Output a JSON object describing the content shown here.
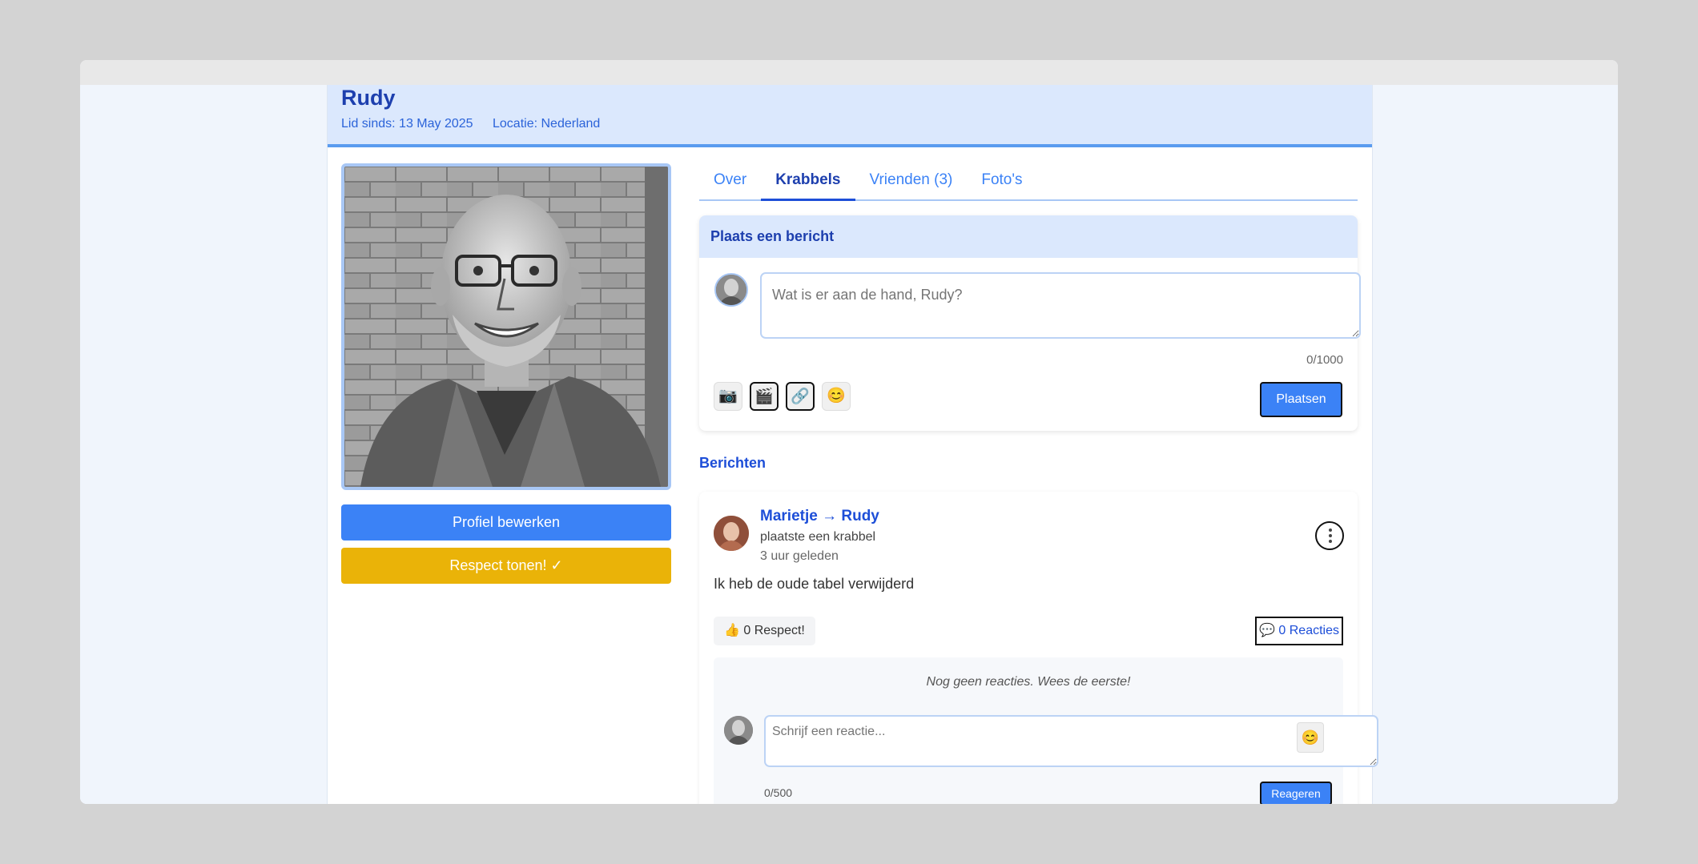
{
  "profile": {
    "name": "Rudy",
    "member_since": "Lid sinds: 13 May 2025",
    "location": "Locatie: Nederland"
  },
  "actions": {
    "edit_profile": "Profiel bewerken",
    "show_respect": "Respect tonen! ✓"
  },
  "tabs": [
    {
      "label": "Over",
      "active": false
    },
    {
      "label": "Krabbels",
      "active": true
    },
    {
      "label": "Vrienden (3)",
      "active": false
    },
    {
      "label": "Foto's",
      "active": false
    }
  ],
  "compose": {
    "title": "Plaats een bericht",
    "placeholder": "Wat is er aan de hand, Rudy?",
    "char_count": "0/1000",
    "tools": [
      "camera-icon",
      "film-icon",
      "link-icon",
      "smiley-icon"
    ],
    "tool_glyphs": [
      "📷",
      "🎬",
      "🔗",
      "😊"
    ],
    "submit_label": "Plaatsen"
  },
  "messages_title": "Berichten",
  "message": {
    "author": "Marietje",
    "arrow": "→",
    "recipient": "Rudy",
    "action": "plaatste een krabbel",
    "time": "3 uur geleden",
    "text": "Ik heb de oude tabel verwijderd",
    "respect_icon": "👍",
    "respect_label": "0 Respect!",
    "reactions_icon": "💬",
    "reactions_label": "0 Reacties",
    "no_reactions": "Nog geen reacties. Wees de eerste!",
    "reply_placeholder": "Schrijf een reactie...",
    "reply_emoji": "😊",
    "reply_count": "0/500",
    "reply_submit": "Reageren"
  },
  "colors": {
    "accent": "#3b82f6",
    "heading": "#1d3fae",
    "header_bg": "#dbe8fd",
    "respect_button": "#eab308"
  }
}
